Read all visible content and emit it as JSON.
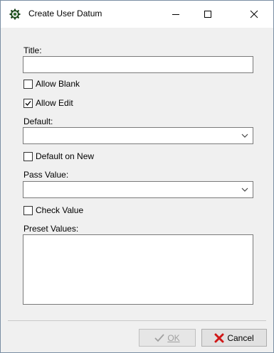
{
  "window": {
    "title": "Create User Datum"
  },
  "fields": {
    "title_label": "Title:",
    "title_value": "",
    "allow_blank_label": "Allow Blank",
    "allow_blank_checked": false,
    "allow_edit_label": "Allow Edit",
    "allow_edit_checked": true,
    "default_label": "Default:",
    "default_value": "",
    "default_on_new_label": "Default on New",
    "default_on_new_checked": false,
    "pass_value_label": "Pass Value:",
    "pass_value_value": "",
    "check_value_label": "Check Value",
    "check_value_checked": false,
    "preset_values_label": "Preset Values:",
    "preset_values_value": ""
  },
  "buttons": {
    "ok_label": "OK",
    "ok_enabled": false,
    "cancel_label": "Cancel"
  },
  "icons": {
    "app": "app-gear-icon",
    "minimize": "minimize-icon",
    "maximize": "maximize-icon",
    "close": "close-icon",
    "ok": "checkmark-icon",
    "cancel": "red-x-icon"
  },
  "colors": {
    "cancel_x": "#d01818",
    "ok_disabled": "#a0a0a0"
  }
}
